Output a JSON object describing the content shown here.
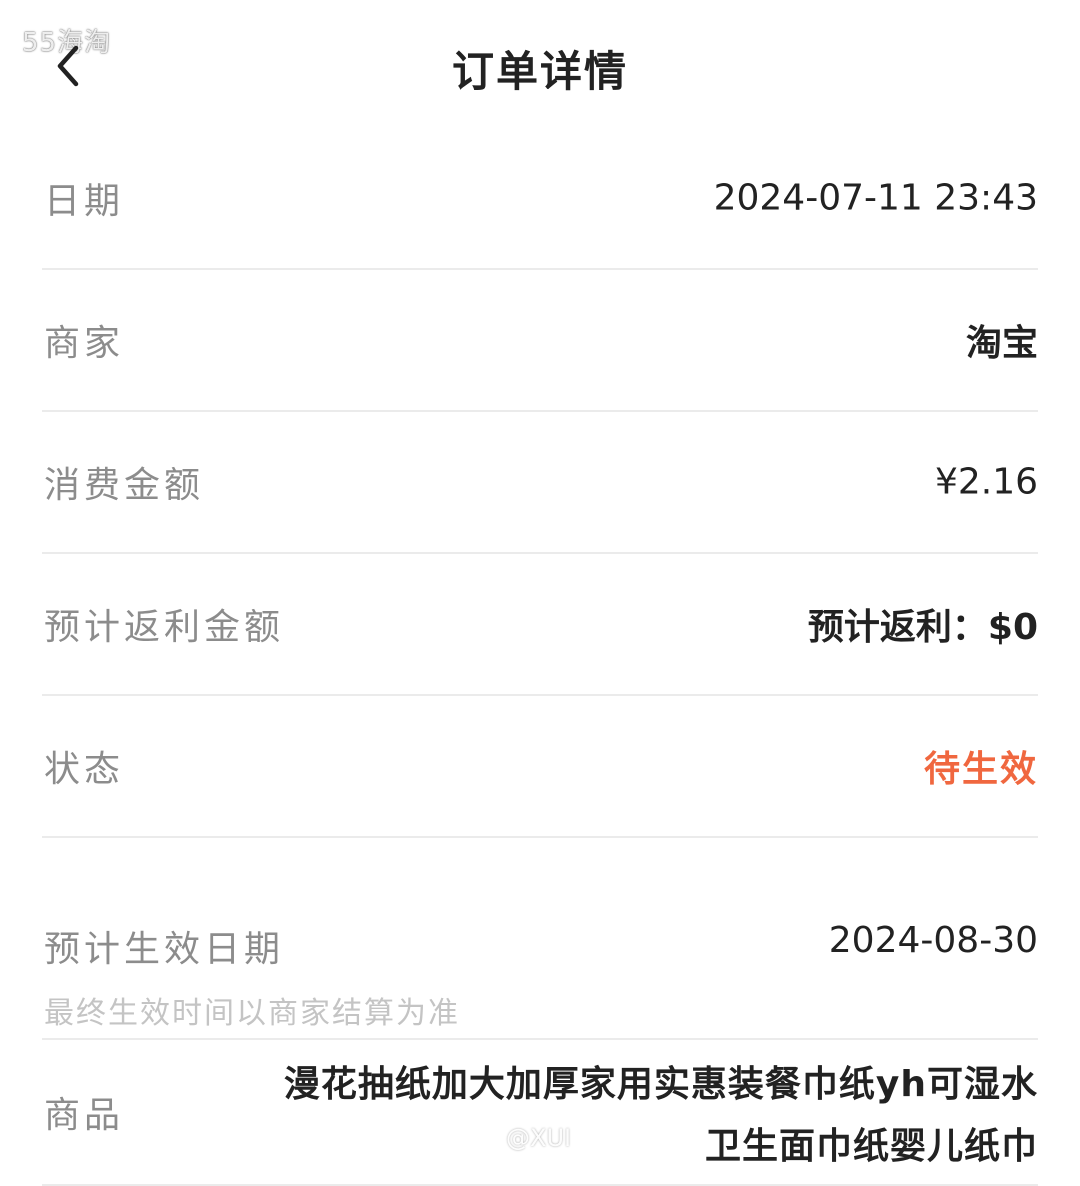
{
  "watermark": {
    "top_text": "55海淘",
    "bottom_text": "@XUI"
  },
  "header": {
    "title": "订单详情",
    "back_icon": "chevron-left-icon"
  },
  "order": {
    "date_label": "日期",
    "date_value": "2024-07-11 23:43",
    "merchant_label": "商家",
    "merchant_value": "淘宝",
    "amount_label": "消费金额",
    "amount_value": "¥2.16",
    "rebate_label": "预计返利金额",
    "rebate_value": "预计返利：$0",
    "status_label": "状态",
    "status_value": "待生效",
    "effective_label": "预计生效日期",
    "effective_value": "2024-08-30",
    "effective_note": "最终生效时间以商家结算为准",
    "product_label": "商品",
    "product_line1": "漫花抽纸加大加厚家用实惠装餐巾纸yh可湿水",
    "product_line2": "卫生面巾纸婴儿纸巾"
  },
  "colors": {
    "status": "#f0673f",
    "label": "#8c8c8c",
    "divider": "#ebebeb",
    "note": "#c4c4c4"
  }
}
